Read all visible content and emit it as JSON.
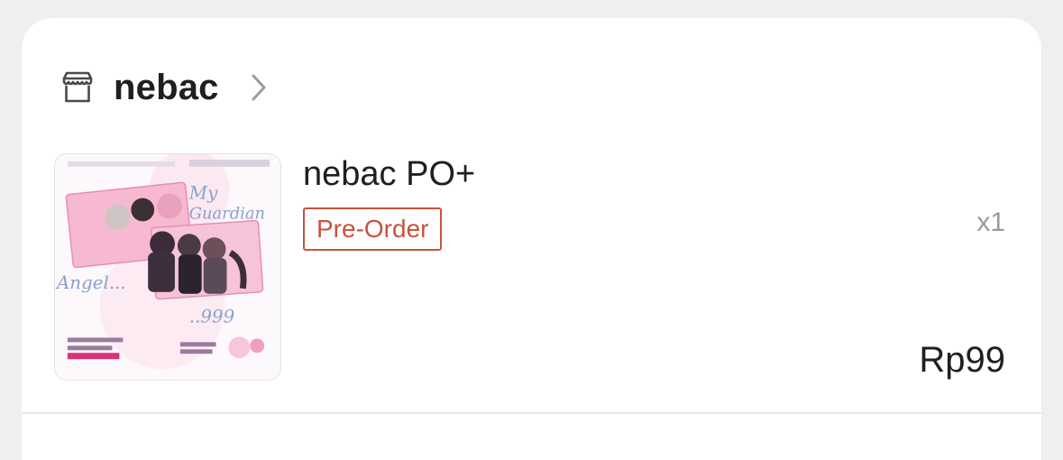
{
  "shop": {
    "icon": "store-icon",
    "name": "nebac",
    "chevron_icon": "chevron-right-icon"
  },
  "item": {
    "thumbnail_icon": "product-thumbnail",
    "title": "nebac PO+",
    "badge": "Pre-Order",
    "quantity": "x1",
    "price": "Rp99"
  },
  "colors": {
    "badge": "#c8533c",
    "background": "#efefef",
    "card": "#ffffff"
  }
}
